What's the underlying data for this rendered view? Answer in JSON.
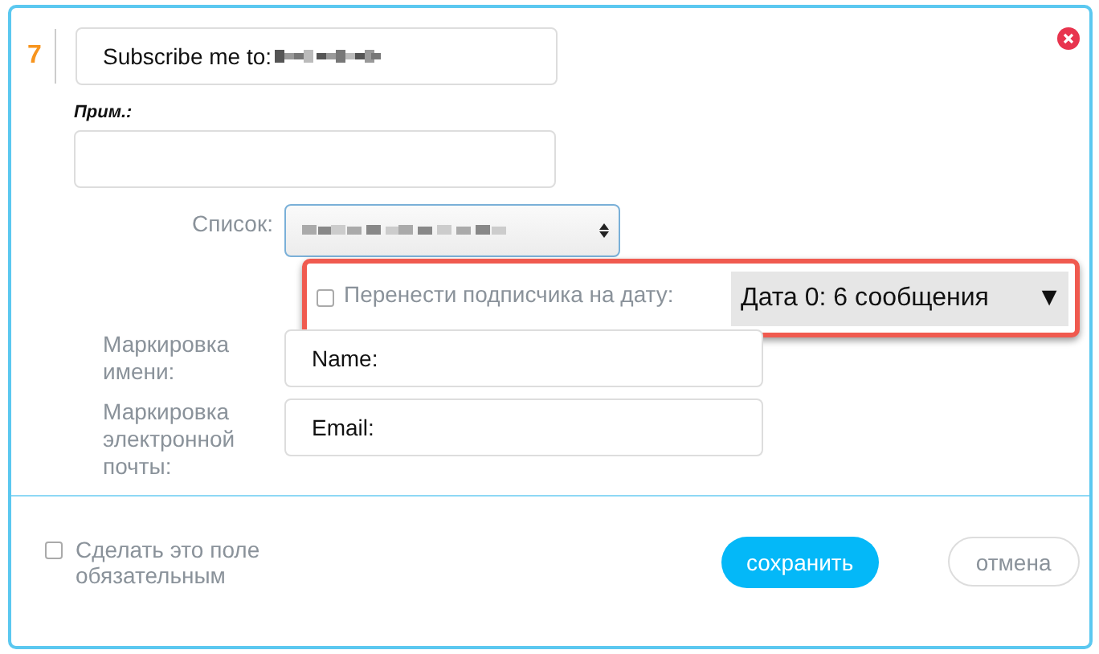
{
  "field_number": "7",
  "question": {
    "value": "Subscribe me to:"
  },
  "note": {
    "label": "Прим.:"
  },
  "list": {
    "label": "Список:"
  },
  "move_subscriber": {
    "checked": false,
    "label": "Перенести подписчика на дату:",
    "date": "Дата 0: 6 сообщения",
    "arrow": "▼"
  },
  "mappings": [
    {
      "label": "Маркировка имени:",
      "value": "Name:"
    },
    {
      "label": "Маркировка электронной почты:",
      "value": "Email:"
    }
  ],
  "required": {
    "checked": false,
    "label": "Сделать это поле обязательным"
  },
  "buttons": [
    {
      "kind": "primary",
      "label": "сохранить"
    },
    {
      "kind": "secondary",
      "label": "отмена"
    }
  ]
}
